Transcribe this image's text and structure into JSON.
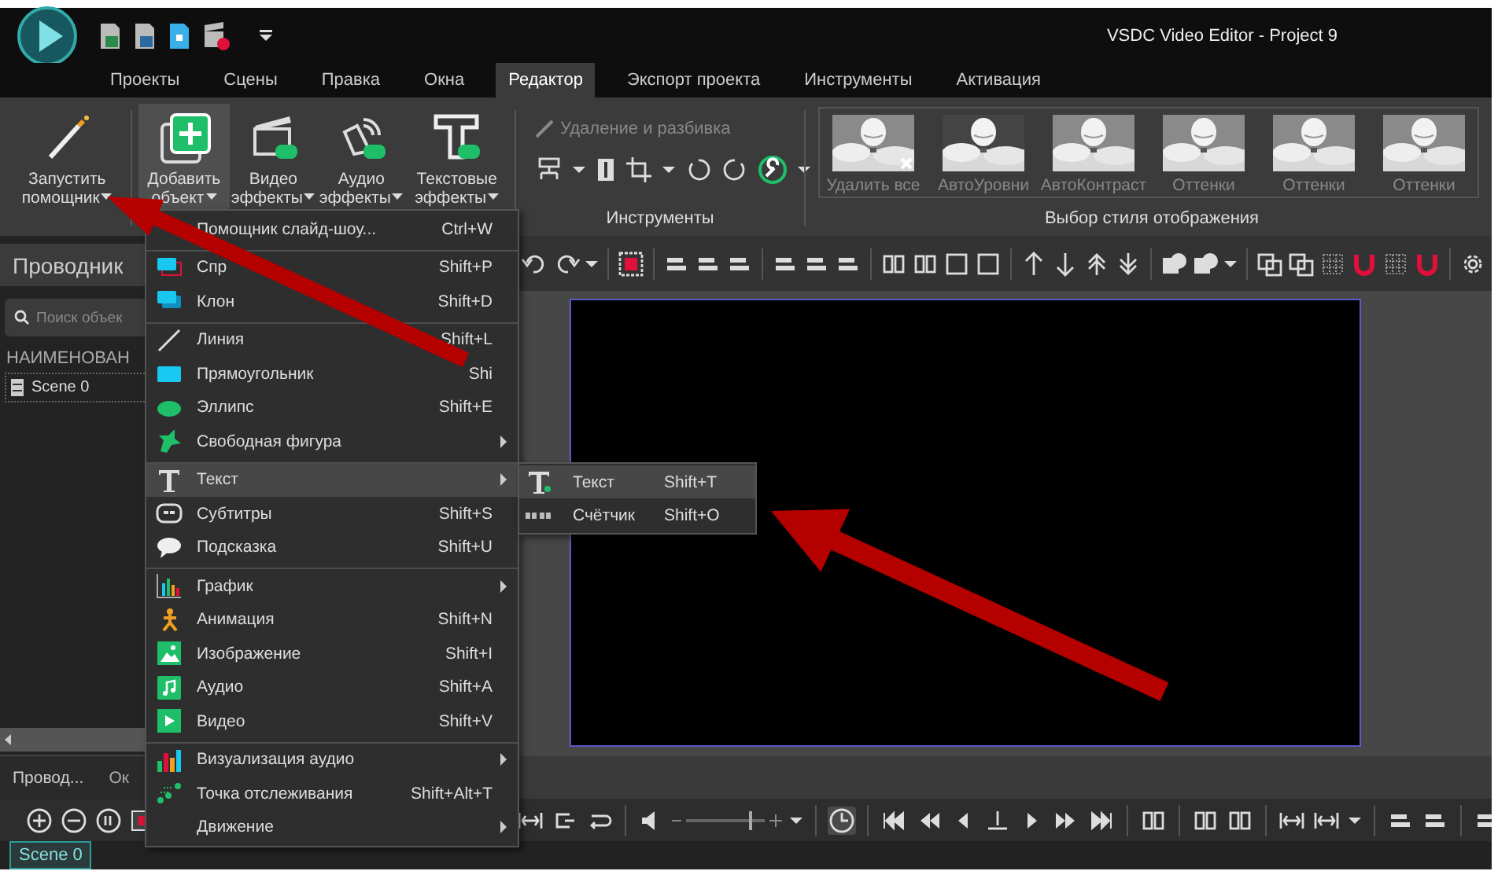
{
  "title_bar": {
    "title": "VSDC Video Editor - Project 9"
  },
  "tabs": [
    {
      "label": "Проекты",
      "selected": false
    },
    {
      "label": "Сцены",
      "selected": false
    },
    {
      "label": "Правка",
      "selected": false
    },
    {
      "label": "Окна",
      "selected": false
    },
    {
      "label": "Редактор",
      "selected": true
    },
    {
      "label": "Экспорт проекта",
      "selected": false
    },
    {
      "label": "Инструменты",
      "selected": false
    },
    {
      "label": "Активация",
      "selected": false
    }
  ],
  "ribbon": {
    "buttons": [
      {
        "lines": [
          "Запустить",
          "помощник"
        ],
        "selected": false
      },
      {
        "lines": [
          "Добавить",
          "объект"
        ],
        "selected": true
      },
      {
        "lines": [
          "Видео",
          "эффекты"
        ],
        "selected": false
      },
      {
        "lines": [
          "Аудио",
          "эффекты"
        ],
        "selected": false
      },
      {
        "lines": [
          "Текстовые",
          "эффекты"
        ],
        "selected": false
      }
    ],
    "tools": {
      "action": "Удаление и разбивка",
      "disabled": true,
      "label": "Инструменты"
    },
    "styles": {
      "items": [
        "Удалить все",
        "АвтоУровни",
        "АвтоКонтраст",
        "Оттенки",
        "Оттенки",
        "Оттенки"
      ],
      "label": "Выбор стиля отображения"
    }
  },
  "explorer": {
    "title": "Проводник",
    "placeholder": "Поиск объек",
    "column": "НАИМЕНОВАН",
    "items": [
      {
        "label": "Scene 0"
      }
    ]
  },
  "bottom_tabs": [
    {
      "label": "Провод...",
      "selected": true
    },
    {
      "label": "Ок",
      "selected": false
    }
  ],
  "volume": {
    "level": 0.8
  },
  "scene_tabs": [
    {
      "label": "Scene 0",
      "selected": true
    }
  ],
  "menu": {
    "items": [
      {
        "label": "Помощник слайд-шоу...",
        "shortcut": "Ctrl+W",
        "submenu": false,
        "separator": false,
        "highlighted": false
      },
      {
        "label": "Спр",
        "shortcut": "Shift+P",
        "submenu": false,
        "separator": true,
        "highlighted": false
      },
      {
        "label": "Клон",
        "shortcut": "Shift+D",
        "submenu": false,
        "separator": false,
        "highlighted": false
      },
      {
        "label": "Линия",
        "shortcut": "Shift+L",
        "submenu": false,
        "separator": true,
        "highlighted": false
      },
      {
        "label": "Прямоугольник",
        "shortcut": "Shi",
        "submenu": false,
        "separator": false,
        "highlighted": false
      },
      {
        "label": "Эллипс",
        "shortcut": "Shift+E",
        "submenu": false,
        "separator": false,
        "highlighted": false
      },
      {
        "label": "Свободная фигура",
        "submenu": true,
        "separator": false,
        "highlighted": false
      },
      {
        "label": "Текст",
        "submenu": true,
        "separator": true,
        "highlighted": true
      },
      {
        "label": "Субтитры",
        "shortcut": "Shift+S",
        "submenu": false,
        "separator": false,
        "highlighted": false
      },
      {
        "label": "Подсказка",
        "shortcut": "Shift+U",
        "submenu": false,
        "separator": false,
        "highlighted": false
      },
      {
        "label": "График",
        "submenu": true,
        "separator": true,
        "highlighted": false
      },
      {
        "label": "Анимация",
        "shortcut": "Shift+N",
        "submenu": false,
        "separator": false,
        "highlighted": false
      },
      {
        "label": "Изображение",
        "shortcut": "Shift+I",
        "submenu": false,
        "separator": false,
        "highlighted": false
      },
      {
        "label": "Аудио",
        "shortcut": "Shift+A",
        "submenu": false,
        "separator": false,
        "highlighted": false
      },
      {
        "label": "Видео",
        "shortcut": "Shift+V",
        "submenu": false,
        "separator": false,
        "highlighted": false
      },
      {
        "label": "Визуализация аудио",
        "submenu": true,
        "separator": true,
        "highlighted": false
      },
      {
        "label": "Точка отслеживания",
        "shortcut": "Shift+Alt+T",
        "submenu": false,
        "separator": false,
        "highlighted": false
      },
      {
        "label": "Движение",
        "submenu": true,
        "separator": false,
        "highlighted": false
      }
    ]
  },
  "submenu": {
    "items": [
      {
        "label": "Текст",
        "shortcut": "Shift+T",
        "highlighted": true
      },
      {
        "label": "Счётчик",
        "shortcut": "Shift+O",
        "highlighted": false
      }
    ]
  }
}
